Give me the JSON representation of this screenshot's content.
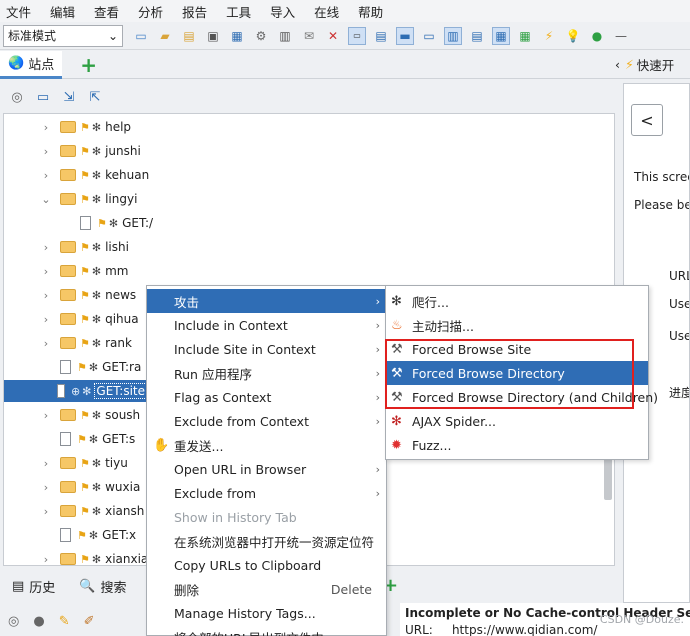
{
  "menubar": {
    "items": [
      "文件",
      "编辑",
      "查看",
      "分析",
      "报告",
      "工具",
      "导入",
      "在线",
      "帮助"
    ]
  },
  "toolbar": {
    "mode_value": "标准模式",
    "icons": [
      "new-session-icon",
      "open-session-icon",
      "save-session-icon",
      "snapshot-icon",
      "export-icon",
      "options-icon",
      "layout-icon",
      "view-icon",
      "request-icon",
      "response-icon",
      "text-icon",
      "layout-1-icon",
      "layout-2-icon",
      "layout-3-icon",
      "panel-1-icon",
      "panel-2-icon",
      "panel-3-icon",
      "grid-icon",
      "scan-icon",
      "bulb-icon",
      "break-icon"
    ]
  },
  "sites_panel": {
    "tab_label": "站点",
    "add_icon": "plus-icon"
  },
  "quick_start": {
    "tab_label": "快速开"
  },
  "tree": {
    "rows": [
      {
        "label": "help",
        "type": "folder",
        "expander": "›",
        "indent": 0
      },
      {
        "label": "junshi",
        "type": "folder",
        "expander": "›",
        "indent": 0
      },
      {
        "label": "kehuan",
        "type": "folder",
        "expander": "›",
        "indent": 0
      },
      {
        "label": "lingyi",
        "type": "folder",
        "expander": "⌄",
        "indent": 0
      },
      {
        "label": "GET:/",
        "type": "file",
        "expander": "",
        "indent": 1
      },
      {
        "label": "lishi",
        "type": "folder",
        "expander": "›",
        "indent": 0
      },
      {
        "label": "mm",
        "type": "folder",
        "expander": "›",
        "indent": 0
      },
      {
        "label": "news",
        "type": "folder",
        "expander": "›",
        "indent": 0
      },
      {
        "label": "qihua",
        "type": "folder",
        "expander": "›",
        "indent": 0
      },
      {
        "label": "rank",
        "type": "folder",
        "expander": "›",
        "indent": 0
      },
      {
        "label": "GET:ra",
        "type": "file",
        "expander": "",
        "indent": 0
      },
      {
        "label": "GET:site",
        "type": "file",
        "expander": "",
        "indent": 0,
        "selected": true
      },
      {
        "label": "soush",
        "type": "folder",
        "expander": "›",
        "indent": 0
      },
      {
        "label": "GET:s",
        "type": "file",
        "expander": "",
        "indent": 0
      },
      {
        "label": "tiyu",
        "type": "folder",
        "expander": "›",
        "indent": 0
      },
      {
        "label": "wuxia",
        "type": "folder",
        "expander": "›",
        "indent": 0
      },
      {
        "label": "xiansh",
        "type": "folder",
        "expander": "›",
        "indent": 0
      },
      {
        "label": "GET:x",
        "type": "file",
        "expander": "",
        "indent": 0
      },
      {
        "label": "xianxia",
        "type": "folder",
        "expander": "›",
        "indent": 0
      }
    ]
  },
  "bottom_tabs": {
    "history": "历史",
    "search": "搜索"
  },
  "right_panel": {
    "back": "<",
    "line1": "This scree",
    "line2": "Please be",
    "url_label": "URL",
    "user1": "Use",
    "user2": "Use",
    "progress": "进度"
  },
  "alert": {
    "title": "Incomplete or No Cache-control Header Set",
    "url_label": "URL:",
    "url_value": "https://www.qidian.com/"
  },
  "watermark": "CSDN @Douze.",
  "context_menu": {
    "items": [
      {
        "label": "攻击",
        "arrow": true,
        "highlighted": true
      },
      {
        "label": "Include in Context",
        "arrow": true
      },
      {
        "label": "Include Site in Context",
        "arrow": true
      },
      {
        "label": "Run 应用程序",
        "arrow": true
      },
      {
        "label": "Flag as Context",
        "arrow": true
      },
      {
        "label": "Exclude from Context",
        "arrow": true
      },
      {
        "label": "重发送...",
        "icon": "hand-icon"
      },
      {
        "label": "Open URL in Browser",
        "arrow": true
      },
      {
        "label": "Exclude from",
        "arrow": true
      },
      {
        "label": "Show in History Tab",
        "disabled": true
      },
      {
        "label": "在系统浏览器中打开统一资源定位符"
      },
      {
        "label": "Copy URLs to Clipboard"
      },
      {
        "label": "删除",
        "shortcut": "Delete"
      },
      {
        "label": "Manage History Tags..."
      },
      {
        "label": "将全部的URL导出到文件中..."
      }
    ]
  },
  "attack_submenu": {
    "items": [
      {
        "label": "爬行...",
        "icon": "spider-icon"
      },
      {
        "label": "主动扫描...",
        "icon": "flame-icon"
      },
      {
        "label": "Forced Browse Site",
        "icon": "hammer-icon"
      },
      {
        "label": "Forced Browse Directory",
        "icon": "hammer-icon",
        "highlighted": true
      },
      {
        "label": "Forced Browse Directory (and Children)",
        "icon": "hammer-icon"
      },
      {
        "label": "AJAX Spider...",
        "icon": "ajax-spider-icon"
      },
      {
        "label": "Fuzz...",
        "icon": "fuzz-icon"
      }
    ]
  },
  "colors": {
    "selection": "#2f6db5",
    "highlight_box": "#e0201e",
    "accent_green": "#2ea043"
  }
}
